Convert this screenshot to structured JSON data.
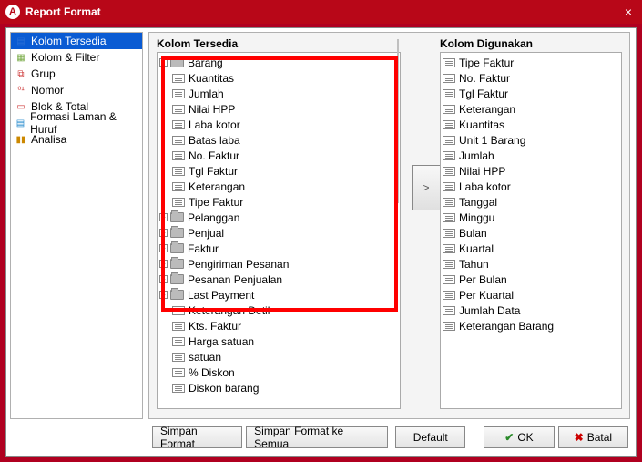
{
  "window": {
    "title": "Report Format",
    "close": "×"
  },
  "sidebar": {
    "items": [
      {
        "label": "Kolom Tersedia"
      },
      {
        "label": "Kolom & Filter"
      },
      {
        "label": "Grup"
      },
      {
        "label": "Nomor"
      },
      {
        "label": "Blok & Total"
      },
      {
        "label": "Formasi Laman & Huruf"
      },
      {
        "label": "Analisa"
      }
    ]
  },
  "panel": {
    "left_title": "Kolom Tersedia",
    "right_title": "Kolom Digunakan",
    "tree": [
      {
        "t": "folder",
        "d": 0,
        "exp": "-",
        "label": "Barang"
      },
      {
        "t": "field",
        "d": 1,
        "label": "Kuantitas"
      },
      {
        "t": "field",
        "d": 1,
        "label": "Jumlah"
      },
      {
        "t": "field",
        "d": 1,
        "label": "Nilai HPP"
      },
      {
        "t": "field",
        "d": 1,
        "label": "Laba kotor"
      },
      {
        "t": "field",
        "d": 1,
        "label": "Batas laba"
      },
      {
        "t": "field",
        "d": 1,
        "label": "No. Faktur"
      },
      {
        "t": "field",
        "d": 1,
        "label": "Tgl Faktur"
      },
      {
        "t": "field",
        "d": 1,
        "label": "Keterangan"
      },
      {
        "t": "field",
        "d": 1,
        "label": "Tipe Faktur"
      },
      {
        "t": "folder",
        "d": 0,
        "exp": "+",
        "label": "Pelanggan"
      },
      {
        "t": "folder",
        "d": 0,
        "exp": "+",
        "label": "Penjual"
      },
      {
        "t": "folder",
        "d": 0,
        "exp": "+",
        "label": "Faktur"
      },
      {
        "t": "folder",
        "d": 0,
        "exp": "+",
        "label": "Pengiriman Pesanan"
      },
      {
        "t": "folder",
        "d": 0,
        "exp": "+",
        "label": "Pesanan Penjualan"
      },
      {
        "t": "folder",
        "d": 0,
        "exp": "+",
        "label": "Last Payment"
      },
      {
        "t": "field",
        "d": 1,
        "label": "Keterangan Detil"
      },
      {
        "t": "field",
        "d": 1,
        "label": "Kts. Faktur"
      },
      {
        "t": "field",
        "d": 1,
        "label": "Harga satuan"
      },
      {
        "t": "field",
        "d": 1,
        "label": "satuan"
      },
      {
        "t": "field",
        "d": 1,
        "label": "% Diskon"
      },
      {
        "t": "field",
        "d": 1,
        "label": "Diskon barang"
      }
    ],
    "used": [
      "Tipe Faktur",
      "No. Faktur",
      "Tgl Faktur",
      "Keterangan",
      "Kuantitas",
      "Unit 1 Barang",
      "Jumlah",
      "Nilai HPP",
      "Laba kotor",
      "Tanggal",
      "Minggu",
      "Bulan",
      "Kuartal",
      "Tahun",
      "Per Bulan",
      "Per Kuartal",
      "Jumlah Data",
      "Keterangan Barang"
    ],
    "move": ">"
  },
  "buttons": {
    "save": "Simpan Format",
    "save_all": "Simpan Format ke Semua",
    "default": "Default",
    "ok": "OK",
    "cancel": "Batal"
  }
}
